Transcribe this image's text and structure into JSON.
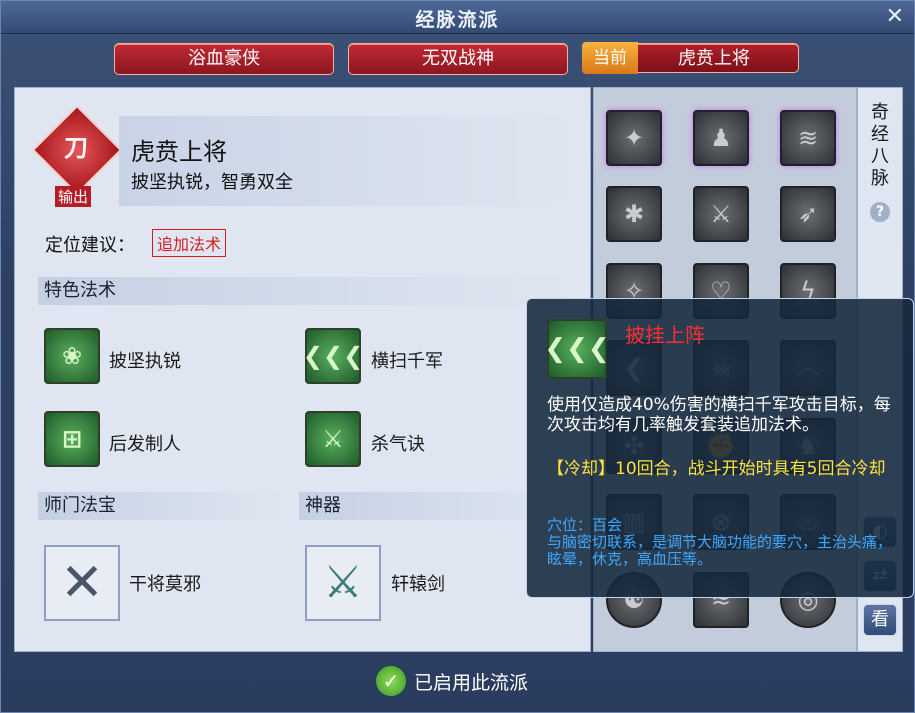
{
  "window": {
    "title": "经脉流派",
    "close": "✕"
  },
  "tabs": [
    {
      "label": "浴血豪侠"
    },
    {
      "label": "无双战神"
    },
    {
      "badge": "当前",
      "label": "虎贲上将"
    }
  ],
  "school": {
    "name": "虎贲上将",
    "motto": "披坚执锐，智勇双全",
    "role_badge": "输出",
    "role_glyph": "刀"
  },
  "positioning": {
    "label": "定位建议：",
    "tag": "追加法术"
  },
  "features": {
    "title": "特色法术",
    "skills": [
      {
        "name": "披坚执锐",
        "icon": "armor-icon",
        "glyph": "❀"
      },
      {
        "name": "横扫千军",
        "icon": "chevrons-icon",
        "glyph": "❮❮❮"
      },
      {
        "name": "后发制人",
        "icon": "gate-icon",
        "glyph": "⊞"
      },
      {
        "name": "杀气诀",
        "icon": "sword-icon",
        "glyph": "⚔"
      }
    ]
  },
  "treasure": {
    "title": "师门法宝",
    "name": "干将莫邪",
    "icon": "twin-swords-icon",
    "glyph": "✕"
  },
  "artifact": {
    "title": "神器",
    "name": "轩辕剑",
    "icon": "sword-artifact-icon",
    "glyph": "⚔"
  },
  "meridian_grid": [
    {
      "icon": "demon-icon",
      "glyph": "✦"
    },
    {
      "icon": "warrior-icon",
      "glyph": "♟"
    },
    {
      "icon": "slash-icon",
      "glyph": "≋"
    },
    {
      "icon": "burst-icon",
      "glyph": "✱"
    },
    {
      "icon": "sword-crossed-icon",
      "glyph": "⚔"
    },
    {
      "icon": "claw-icon",
      "glyph": "➶"
    },
    {
      "icon": "star-icon",
      "glyph": "✧"
    },
    {
      "icon": "shield-icon",
      "glyph": "♡"
    },
    {
      "icon": "lightning-icon",
      "glyph": "ϟ"
    },
    {
      "icon": "chevrons-icon",
      "glyph": "❮"
    },
    {
      "icon": "skull-icon",
      "glyph": "☠"
    },
    {
      "icon": "dragon-icon",
      "glyph": "෴"
    },
    {
      "icon": "rune-icon",
      "glyph": "✣"
    },
    {
      "icon": "fist-icon",
      "glyph": "✊"
    },
    {
      "icon": "beast-icon",
      "glyph": "♞"
    },
    {
      "icon": "pillar-icon",
      "glyph": "▥"
    },
    {
      "icon": "circle-icon",
      "glyph": "⊗"
    },
    {
      "icon": "cauldron-icon",
      "glyph": "♨"
    },
    {
      "icon": "spiral-icon",
      "glyph": "☯"
    },
    {
      "icon": "wave-icon",
      "glyph": "≈"
    },
    {
      "icon": "eye-icon",
      "glyph": "◎"
    }
  ],
  "sidebar": {
    "label": "奇经八脉",
    "help": "?",
    "btn1": "◐",
    "btn2": "⇄",
    "btn3": "看"
  },
  "tooltip": {
    "name": "披挂上阵",
    "glyph": "❮❮❮",
    "desc": "使用仅造成40%伤害的横扫千军攻击目标，每次攻击均有几率触发套装追加法术。",
    "cooldown": "【冷却】10回合，战斗开始时具有5回合冷却",
    "acupoint": "穴位：百会\n与脑密切联系，是调节大脑功能的要穴，主治头痛，眩晕，休克，高血压等。"
  },
  "footer": {
    "status": "已启用此流派",
    "check": "✓"
  },
  "colors": {
    "tab_red": "#b0202a",
    "badge_orange": "#e89030",
    "tooltip_name": "#ff2e2e",
    "cooldown": "#ffe23a",
    "acupoint": "#3fa8ff"
  }
}
